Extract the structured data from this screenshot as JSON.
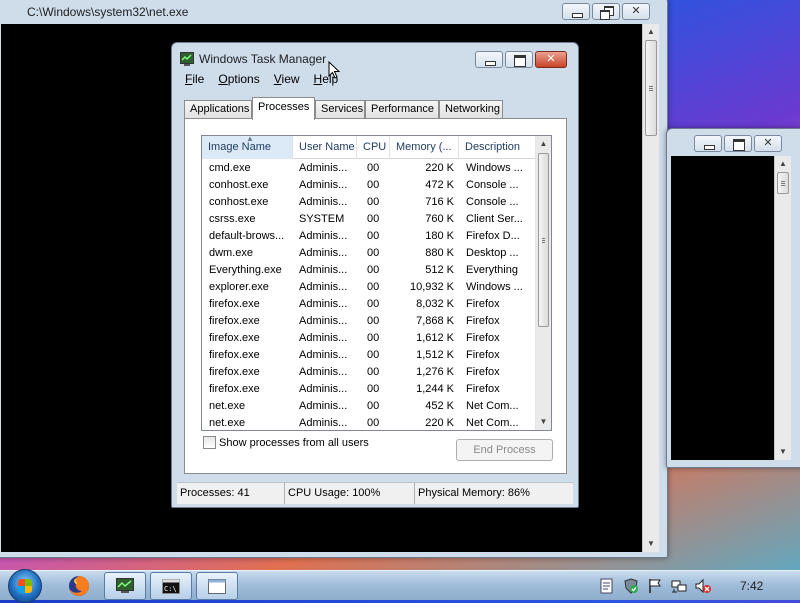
{
  "colors": {
    "console_bg": "#000000",
    "titlebar_close": "#c8432a",
    "selected_header_bg": "#dceaf7",
    "window_frame": "#cfdcea"
  },
  "console_window": {
    "title": "C:\\Windows\\system32\\net.exe",
    "icon": "console-icon"
  },
  "task_manager": {
    "title": "Windows Task Manager",
    "menu": [
      "File",
      "Options",
      "View",
      "Help"
    ],
    "tabs": [
      "Applications",
      "Processes",
      "Services",
      "Performance",
      "Networking"
    ],
    "active_tab": "Processes",
    "columns": [
      "Image Name",
      "User Name",
      "CPU",
      "Memory (...",
      "Description"
    ],
    "sorted_column": "Image Name",
    "rows": [
      [
        "cmd.exe",
        "Adminis...",
        "00",
        "220 K",
        "Windows ..."
      ],
      [
        "conhost.exe",
        "Adminis...",
        "00",
        "472 K",
        "Console ..."
      ],
      [
        "conhost.exe",
        "Adminis...",
        "00",
        "716 K",
        "Console ..."
      ],
      [
        "csrss.exe",
        "SYSTEM",
        "00",
        "760 K",
        "Client Ser..."
      ],
      [
        "default-brows...",
        "Adminis...",
        "00",
        "180 K",
        "Firefox D..."
      ],
      [
        "dwm.exe",
        "Adminis...",
        "00",
        "880 K",
        "Desktop ..."
      ],
      [
        "Everything.exe",
        "Adminis...",
        "00",
        "512 K",
        "Everything"
      ],
      [
        "explorer.exe",
        "Adminis...",
        "00",
        "10,932 K",
        "Windows ..."
      ],
      [
        "firefox.exe",
        "Adminis...",
        "00",
        "8,032 K",
        "Firefox"
      ],
      [
        "firefox.exe",
        "Adminis...",
        "00",
        "7,868 K",
        "Firefox"
      ],
      [
        "firefox.exe",
        "Adminis...",
        "00",
        "1,612 K",
        "Firefox"
      ],
      [
        "firefox.exe",
        "Adminis...",
        "00",
        "1,512 K",
        "Firefox"
      ],
      [
        "firefox.exe",
        "Adminis...",
        "00",
        "1,276 K",
        "Firefox"
      ],
      [
        "firefox.exe",
        "Adminis...",
        "00",
        "1,244 K",
        "Firefox"
      ],
      [
        "net.exe",
        "Adminis...",
        "00",
        "452 K",
        "Net Com..."
      ],
      [
        "net.exe",
        "Adminis...",
        "00",
        "220 K",
        "Net Com..."
      ]
    ],
    "show_all_label": "Show processes from all users",
    "show_all_checked": false,
    "end_process_label": "End Process",
    "end_process_enabled": false,
    "status": {
      "processes": "Processes: 41",
      "cpu": "CPU Usage: 100%",
      "memory": "Physical Memory: 86%"
    }
  },
  "taskbar": {
    "pinned": [
      "firefox-icon"
    ],
    "open_windows": [
      "task-manager-icon",
      "console-icon",
      "window-icon"
    ],
    "tray": [
      "notes-icon",
      "security-shield-icon",
      "action-center-flag-icon",
      "network-icon",
      "volume-muted-icon"
    ],
    "clock": "7:42"
  }
}
